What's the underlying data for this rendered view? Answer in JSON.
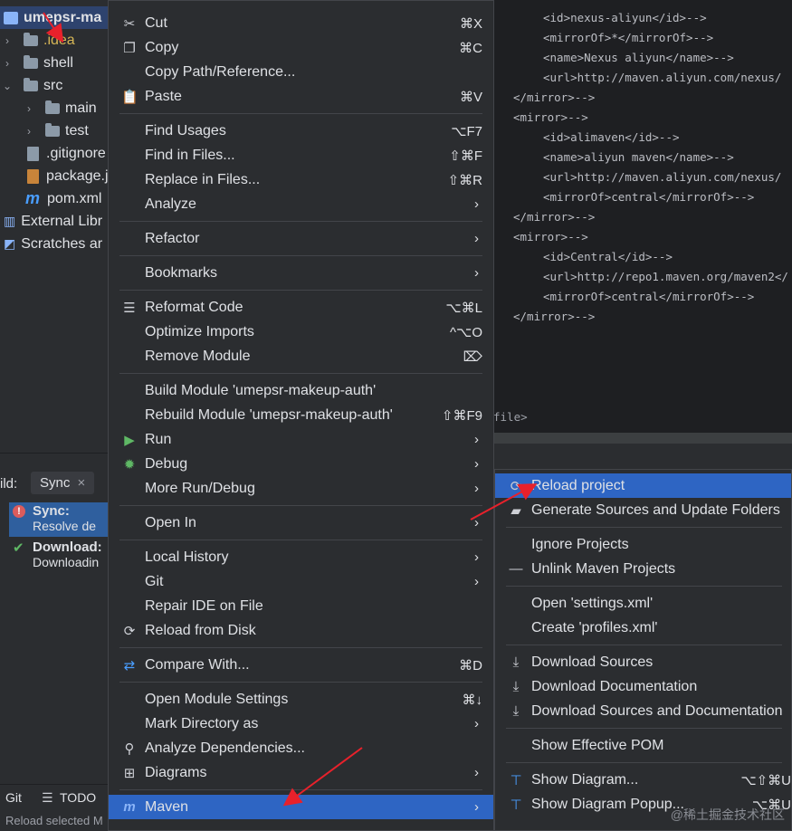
{
  "project_tree": {
    "root": "umepsr-ma",
    "items": [
      {
        "label": ".idea",
        "icon": "folder-icon",
        "color": "#d6b656"
      },
      {
        "label": "shell",
        "icon": "folder-icon"
      },
      {
        "label": "src",
        "icon": "folder-icon"
      },
      {
        "label": "main",
        "icon": "folder-icon"
      },
      {
        "label": "test",
        "icon": "folder-icon"
      },
      {
        "label": ".gitignore",
        "icon": "file-icon"
      },
      {
        "label": "package.j",
        "icon": "file-icon"
      },
      {
        "label": "pom.xml",
        "icon": "maven-icon"
      },
      {
        "label": "External Libr",
        "icon": "library-icon"
      },
      {
        "label": "Scratches ar",
        "icon": "scratch-icon"
      }
    ]
  },
  "editor": {
    "lines": [
      "<id>nexus-aliyun</id>-->",
      "<mirrorOf>*</mirrorOf>-->",
      "<name>Nexus aliyun</name>-->",
      "<url>http://maven.aliyun.com/nexus/",
      "</mirror>-->",
      "<mirror>-->",
      "<id>alimaven</id>-->",
      "<name>aliyun maven</name>-->",
      "<url>http://maven.aliyun.com/nexus/",
      "<mirrorOf>central</mirrorOf>-->",
      "</mirror>-->",
      "<mirror>-->",
      "<id>Central</id>-->",
      "<url>http://repo1.maven.org/maven2</",
      "<mirrorOf>central</mirrorOf>-->",
      "</mirror>-->"
    ],
    "footer": "file>"
  },
  "build_panel": {
    "prefix": "ild:",
    "tab": "Sync",
    "sync_title": "Sync:",
    "sync_sub": "Resolve de",
    "download_title": "Download:",
    "download_sub": "Downloadin"
  },
  "bottom_bar": {
    "git": "Git",
    "todo": "TODO",
    "status": "Reload selected M"
  },
  "context_menu": {
    "items": [
      {
        "label": "Cut",
        "shortcut": "⌘X",
        "icon": "scissors-icon"
      },
      {
        "label": "Copy",
        "shortcut": "⌘C",
        "icon": "copy-icon"
      },
      {
        "label": "Copy Path/Reference...",
        "shortcut": ""
      },
      {
        "label": "Paste",
        "shortcut": "⌘V",
        "icon": "clipboard-icon"
      },
      {
        "label": "Find Usages",
        "shortcut": "⌥F7"
      },
      {
        "label": "Find in Files...",
        "shortcut": "⇧⌘F"
      },
      {
        "label": "Replace in Files...",
        "shortcut": "⇧⌘R"
      },
      {
        "label": "Analyze",
        "submenu": true
      },
      {
        "label": "Refactor",
        "submenu": true
      },
      {
        "label": "Bookmarks",
        "submenu": true
      },
      {
        "label": "Reformat Code",
        "shortcut": "⌥⌘L",
        "icon": "reformat-icon"
      },
      {
        "label": "Optimize Imports",
        "shortcut": "^⌥O"
      },
      {
        "label": "Remove Module",
        "shortcut": "⌦"
      },
      {
        "label": "Build Module 'umepsr-makeup-auth'",
        "shortcut": ""
      },
      {
        "label": "Rebuild Module 'umepsr-makeup-auth'",
        "shortcut": "⇧⌘F9"
      },
      {
        "label": "Run",
        "submenu": true,
        "icon": "run-icon"
      },
      {
        "label": "Debug",
        "submenu": true,
        "icon": "debug-icon"
      },
      {
        "label": "More Run/Debug",
        "submenu": true
      },
      {
        "label": "Open In",
        "submenu": true
      },
      {
        "label": "Local History",
        "submenu": true
      },
      {
        "label": "Git",
        "submenu": true
      },
      {
        "label": "Repair IDE on File",
        "shortcut": ""
      },
      {
        "label": "Reload from Disk",
        "shortcut": "",
        "icon": "reload-icon"
      },
      {
        "label": "Compare With...",
        "shortcut": "⌘D",
        "icon": "compare-icon"
      },
      {
        "label": "Open Module Settings",
        "shortcut": "⌘↓"
      },
      {
        "label": "Mark Directory as",
        "submenu": true
      },
      {
        "label": "Analyze Dependencies...",
        "shortcut": "",
        "icon": "dependencies-icon"
      },
      {
        "label": "Diagrams",
        "submenu": true,
        "icon": "diagram-icon"
      },
      {
        "label": "Maven",
        "submenu": true,
        "icon": "maven-icon",
        "selected": true
      }
    ]
  },
  "maven_submenu": {
    "items": [
      {
        "label": "Reload project",
        "icon": "reload-icon",
        "selected": true
      },
      {
        "label": "Generate Sources and Update Folders",
        "icon": "generate-folder-icon"
      },
      {
        "label": "Ignore Projects"
      },
      {
        "label": "Unlink Maven Projects",
        "icon": "minus-icon"
      },
      {
        "label": "Open 'settings.xml'"
      },
      {
        "label": "Create 'profiles.xml'"
      },
      {
        "label": "Download Sources",
        "icon": "download-icon"
      },
      {
        "label": "Download Documentation",
        "icon": "download-icon"
      },
      {
        "label": "Download Sources and Documentation",
        "icon": "download-icon"
      },
      {
        "label": "Show Effective POM"
      },
      {
        "label": "Show Diagram...",
        "shortcut": "⌥⇧⌘U",
        "icon": "diagram-icon"
      },
      {
        "label": "Show Diagram Popup...",
        "shortcut": "⌥⌘U",
        "icon": "diagram-icon"
      }
    ]
  },
  "watermark": "@稀土掘金技术社区",
  "colors": {
    "selection": "#2e65c3",
    "background": "#2b2d30",
    "editor_bg": "#1e1f22",
    "arrow": "#e8212b"
  }
}
